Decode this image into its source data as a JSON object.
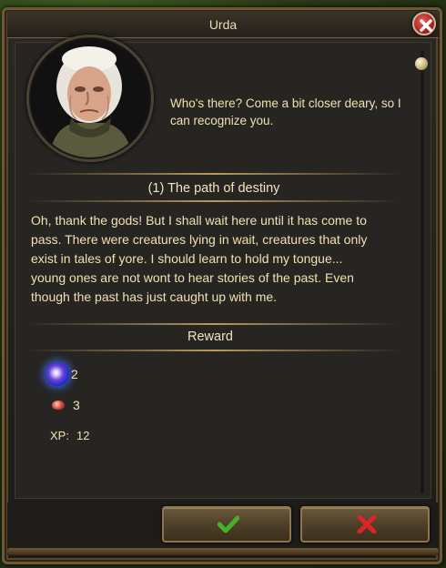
{
  "window": {
    "title": "Urda"
  },
  "npc": {
    "greeting": "Who's there? Come a bit closer deary, so I can recognize you."
  },
  "quest": {
    "title": "(1) The path of destiny",
    "text": "Oh, thank the gods! But I shall wait here until it has come to pass. There were creatures lying in wait, creatures that only exist in tales of yore. I should learn to hold my tongue... young ones are not wont to hear stories of the past. Even though the past has just caught up with me."
  },
  "reward": {
    "heading": "Reward",
    "items": [
      {
        "icon": "magic-orb-icon",
        "amount": "2"
      },
      {
        "icon": "meat-icon",
        "amount": "3"
      }
    ],
    "xp_label": "XP:",
    "xp_value": "12"
  },
  "buttons": {
    "accept_icon": "checkmark-icon",
    "decline_icon": "x-icon"
  },
  "colors": {
    "text": "#f0e0b0",
    "frame": "#6e5734",
    "accept": "#46b028",
    "decline": "#d8262a"
  }
}
